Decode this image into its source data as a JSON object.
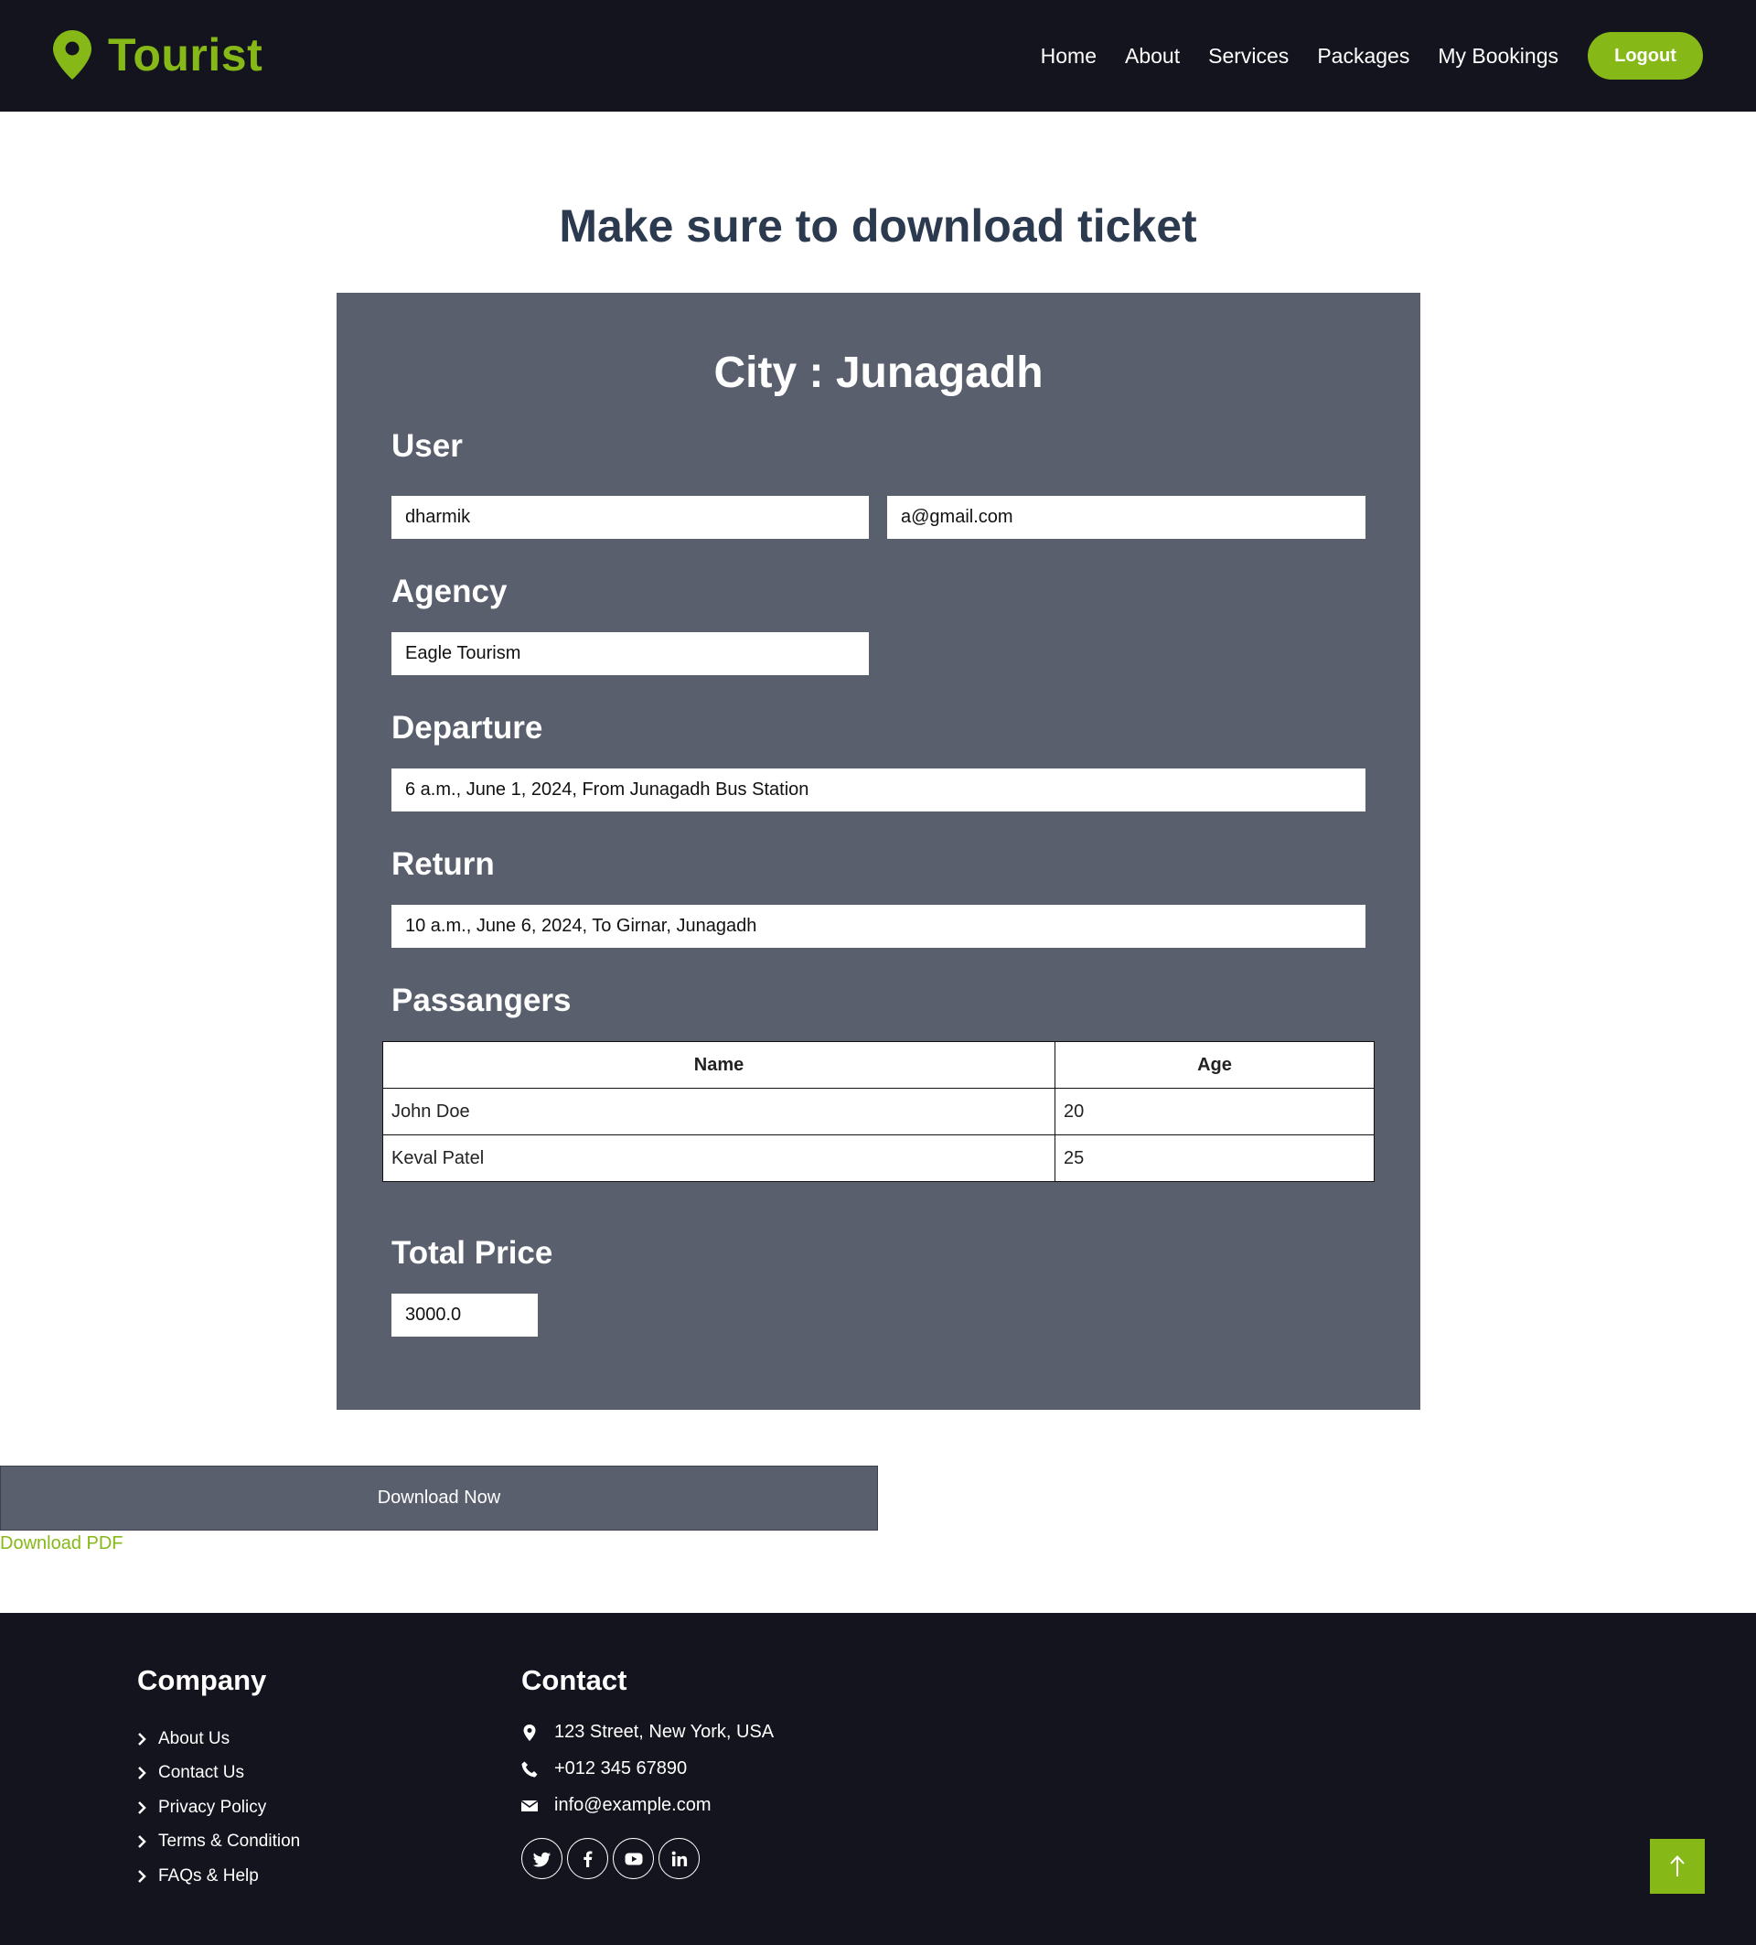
{
  "brand": {
    "name": "Tourist",
    "accent_color": "#86b817",
    "icon": "map-pin-icon"
  },
  "nav": {
    "links": [
      "Home",
      "About",
      "Services",
      "Packages",
      "My Bookings"
    ],
    "logout_label": "Logout"
  },
  "page": {
    "title": "Make sure to download ticket"
  },
  "ticket": {
    "city_title": "City : Junagadh",
    "user": {
      "label": "User",
      "name": "dharmik",
      "email": "a@gmail.com"
    },
    "agency": {
      "label": "Agency",
      "value": "Eagle Tourism"
    },
    "departure": {
      "label": "Departure",
      "value": "6 a.m., June 1, 2024, From Junagadh Bus Station"
    },
    "return": {
      "label": "Return",
      "value": "10 a.m., June 6, 2024, To Girnar, Junagadh"
    },
    "passengers": {
      "label": "Passangers",
      "columns": [
        "Name",
        "Age"
      ],
      "rows": [
        {
          "name": "John Doe",
          "age": "20"
        },
        {
          "name": "Keval Patel",
          "age": "25"
        }
      ]
    },
    "total_price": {
      "label": "Total Price",
      "value": "3000.0"
    },
    "card_color": "#595f6d"
  },
  "download": {
    "button_label": "Download Now",
    "link_label": "Download PDF"
  },
  "footer": {
    "company": {
      "heading": "Company",
      "links": [
        "About Us",
        "Contact Us",
        "Privacy Policy",
        "Terms & Condition",
        "FAQs & Help"
      ]
    },
    "contact": {
      "heading": "Contact",
      "address": "123 Street, New York, USA",
      "phone": "+012 345 67890",
      "email": "info@example.com"
    },
    "socials": [
      "twitter-icon",
      "facebook-icon",
      "youtube-icon",
      "linkedin-icon"
    ],
    "back_to_top_icon": "arrow-up-icon",
    "background_color": "#14141f"
  }
}
